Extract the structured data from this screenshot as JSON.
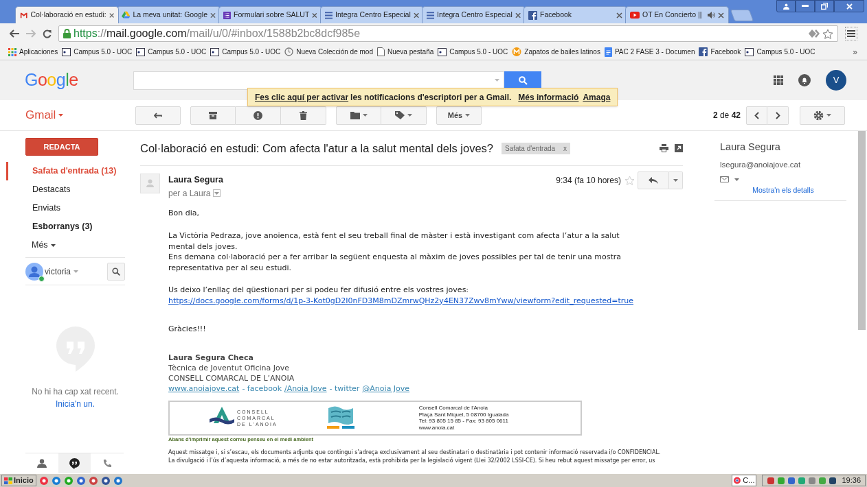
{
  "browser": {
    "tabs": [
      {
        "kind": "gmail",
        "title": "Col·laboració en estudi:",
        "selected": true,
        "audio": false
      },
      {
        "kind": "drive",
        "title": "La meva unitat: Google",
        "selected": false,
        "audio": false
      },
      {
        "kind": "forms",
        "title": "Formulari sobre SALUT",
        "selected": false,
        "audio": false
      },
      {
        "kind": "docs",
        "title": "Integra Centro Especial",
        "selected": false,
        "audio": false
      },
      {
        "kind": "docs",
        "title": "Integra Centro Especial",
        "selected": false,
        "audio": false
      },
      {
        "kind": "facebook",
        "title": "Facebook",
        "selected": false,
        "audio": false
      },
      {
        "kind": "youtube",
        "title": "OT En Concierto ||",
        "selected": false,
        "audio": true
      }
    ],
    "url": {
      "scheme": "https",
      "sep": "://",
      "host": "mail.google.com",
      "path": "/mail/u/0/#inbox/1588b2bc8dcf985e"
    },
    "bookmarks": [
      {
        "kind": "apps",
        "label": "Aplicaciones"
      },
      {
        "kind": "page",
        "label": "Campus 5.0 - UOC"
      },
      {
        "kind": "page",
        "label": "Campus 5.0 - UOC"
      },
      {
        "kind": "page",
        "label": "Campus 5.0 - UOC"
      },
      {
        "kind": "clock",
        "label": "Nueva Colección de mod"
      },
      {
        "kind": "blank",
        "label": "Nueva pestaña"
      },
      {
        "kind": "page",
        "label": "Campus 5.0 - UOC"
      },
      {
        "kind": "orange",
        "label": "Zapatos de bailes latinos"
      },
      {
        "kind": "docs",
        "label": "PAC 2 FASE 3 - Documen"
      },
      {
        "kind": "facebook",
        "label": "Facebook"
      },
      {
        "kind": "page",
        "label": "Campus 5.0 - UOC"
      }
    ],
    "more": "»"
  },
  "header": {
    "logo": "Google",
    "avatar": "V"
  },
  "notification": {
    "link": "Fes clic aquí per activar",
    "text": "les notificacions d'escriptori per a Gmail.",
    "more": "Més informació",
    "hide": "Amaga"
  },
  "toolbar": {
    "app": "Gmail",
    "more": "Més",
    "page": "2",
    "of": "de",
    "total": "42"
  },
  "sidebar": {
    "compose": "REDACTA",
    "folders": [
      {
        "label": "Safata d'entrada (13)",
        "selected": true,
        "unread": true
      },
      {
        "label": "Destacats",
        "selected": false,
        "unread": false
      },
      {
        "label": "Enviats",
        "selected": false,
        "unread": false
      },
      {
        "label": "Esborranys (3)",
        "selected": false,
        "unread": true
      }
    ],
    "more": "Més",
    "chat_user": "victoria",
    "online": true,
    "empty": "No hi ha cap xat recent.",
    "start": "Inicia'n un."
  },
  "email": {
    "subject": "Col·laboració en estudi: Com afecta l'atur a la salut mental dels joves?",
    "label": "Safata d'entrada",
    "label_close": "x",
    "sender": "Laura Segura",
    "to": "per a Laura",
    "time": "9:34 (fa 10 hores)",
    "greeting": "Bon dia,",
    "paragraphs": [
      [
        "La Victòria Pedraza, jove anoienca, està fent el seu treball final de màster i està investigant com afecta l’atur a la salut",
        "mental dels joves.",
        "Ens demana col·laboració per a fer arribar la següent enquesta al màxim de joves possibles per tal de tenir una mostra",
        "representativa per al seu estudi."
      ],
      [
        "Us deixo l’enllaç del qüestionari per si podeu fer difusió entre els vostres joves:"
      ]
    ],
    "link": "https://docs.google.com/forms/d/1p-3-Kot0gD2I0nFD3M8mDZmrwQHz2y4EN37Zwv8mYww/viewform?edit_requested=true",
    "thanks": "Gràcies!!!",
    "signature": {
      "name": "Laura Segura Checa",
      "role": "Tècnica de Joventut Oficina Jove",
      "org": "CONSELL COMARCAL DE L’ANOIA",
      "web": "www.anoiajove.cat",
      "sep1": "- facebook",
      "fb": "/Anoia Jove",
      "sep2": "- twitter",
      "tw": "@Anoia Jove"
    },
    "banner": {
      "logo_lines": [
        "CONSELL",
        "COMARCAL",
        "DE L'ANOIA"
      ],
      "address": [
        "Consell Comarcal de l'Anoia",
        "Plaça Sant Miquel, 5  08700 Igualada",
        "Tel: 93 805 15 85 - Fax: 93 805 0611",
        "www.anoia.cat"
      ],
      "eco": "Abans d'imprimir aquest correu penseu en el medi ambient"
    },
    "disclaimer": [
      "Aquest missatge i, si s’escau, els documents adjunts que contingui s’adreça exclusivament al seu destinatari o destinatària i pot contenir informació reservada i/o CONFIDENCIAL.",
      "La divulgació i l’ús d’aquesta informació, a més de no estar autoritzada, està prohibida per la legislació vigent (Llei 32/2002 LSSI-CE). Si heu rebut aquest missatge per error, us"
    ]
  },
  "contact": {
    "name": "Laura Segura",
    "email": "lsegura@anoiajove.cat",
    "details": "Mostra'n els detalls"
  },
  "taskbar": {
    "start": "Inicio",
    "task": "C...",
    "clock": "19:36"
  }
}
